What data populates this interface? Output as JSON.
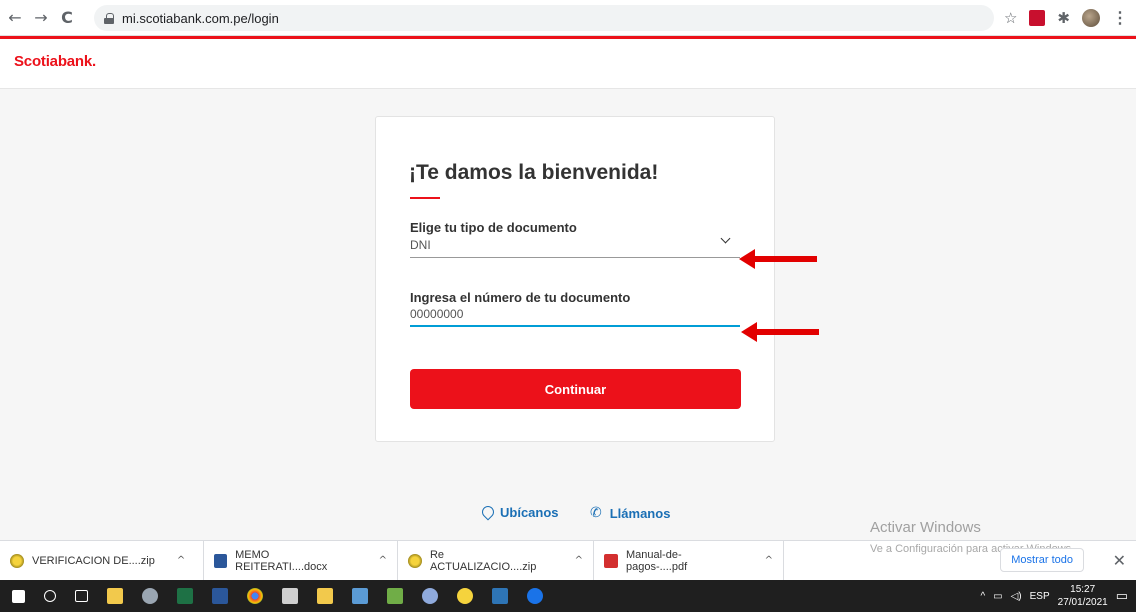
{
  "browser": {
    "back": "←",
    "forward": "→",
    "reload": "C",
    "url": "mi.scotiabank.com.pe/login",
    "star": "☆",
    "puzzle": "✱",
    "menu": "⋮"
  },
  "header": {
    "logo": "Scotiabank"
  },
  "login": {
    "title": "¡Te damos la bienvenida!",
    "doc_type_label": "Elige tu tipo de documento",
    "doc_type_value": "DNI",
    "doc_number_label": "Ingresa el número de tu documento",
    "doc_number_value": "00000000",
    "continue_label": "Continuar"
  },
  "footer": {
    "locate": "Ubícanos",
    "call": "Llámanos"
  },
  "windows_activation": {
    "title": "Activar Windows",
    "subtitle": "Ve a Configuración para activar Windows."
  },
  "downloads": {
    "items": [
      {
        "name": "VERIFICACION DE....zip"
      },
      {
        "name": "MEMO REITERATI....docx"
      },
      {
        "name": "Re ACTUALIZACIO....zip"
      },
      {
        "name": "Manual-de-pagos-....pdf"
      }
    ],
    "show_all": "Mostrar todo",
    "close": "✕"
  },
  "taskbar": {
    "lang": "ESP",
    "time": "15:27",
    "date": "27/01/2021"
  },
  "colors": {
    "brand": "#ec111a",
    "link": "#1a6fb5",
    "active_line": "#009dd6"
  }
}
